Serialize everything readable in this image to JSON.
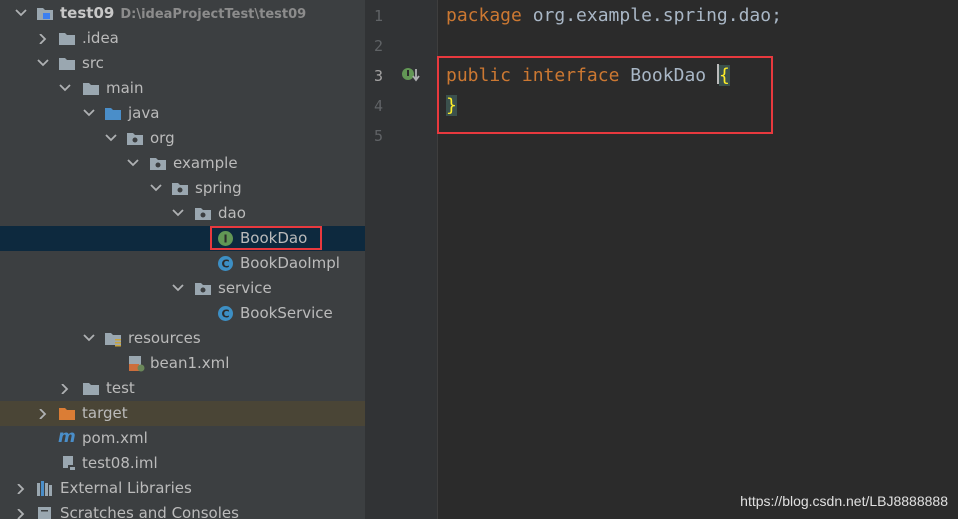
{
  "project_tree": {
    "rows": [
      {
        "label": "test09",
        "path": "D:\\ideaProjectTest\\test09"
      },
      {
        "label": ".idea"
      },
      {
        "label": "src"
      },
      {
        "label": "main"
      },
      {
        "label": "java"
      },
      {
        "label": "org"
      },
      {
        "label": "example"
      },
      {
        "label": "spring"
      },
      {
        "label": "dao"
      },
      {
        "label": "BookDao",
        "badge": "I"
      },
      {
        "label": "BookDaoImpl",
        "badge": "C"
      },
      {
        "label": "service"
      },
      {
        "label": "BookService",
        "badge": "C"
      },
      {
        "label": "resources"
      },
      {
        "label": "bean1.xml"
      },
      {
        "label": "test"
      },
      {
        "label": "target"
      },
      {
        "label": "pom.xml",
        "badge": "m"
      },
      {
        "label": "test08.iml"
      },
      {
        "label": "External Libraries"
      },
      {
        "label": "Scratches and Consoles"
      }
    ]
  },
  "editor": {
    "line_numbers": [
      "1",
      "2",
      "3",
      "4",
      "5"
    ],
    "current_line": "3",
    "lines": {
      "l1_kw": "package",
      "l1_rest": " org.example.spring.dao;",
      "l3_kw1": "public",
      "l3_kw2": "interface",
      "l3_name": " BookDao ",
      "l3_brace": "{",
      "l4_brace": "}"
    }
  },
  "watermark": "https://blog.csdn.net/LBJ8888888",
  "colors": {
    "highlight_box": "#e8393e",
    "keyword": "#cc7832",
    "brace_match": "#ffef28",
    "selection": "#0d293e",
    "excluded_folder": "#4a4536"
  }
}
